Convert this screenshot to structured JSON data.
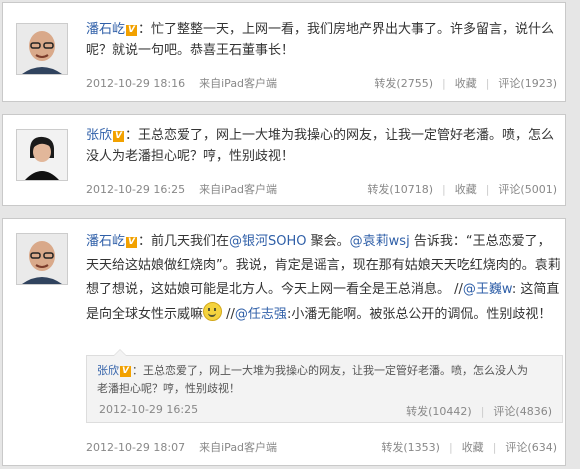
{
  "posts": [
    {
      "author": "潘石屹",
      "verified": "V",
      "text": "：忙了整整一天，上网一看，我们房地产界出大事了。许多留言，说什么呢？就说一句吧。恭喜王石董事长！",
      "time": "2012-10-29 18:16",
      "source": "来自iPad客户端",
      "repost": "转发(2755)",
      "favorite": "收藏",
      "comment": "评论(1923)"
    },
    {
      "author": "张欣",
      "verified": "V",
      "text": "：王总恋爱了，网上一大堆为我操心的网友，让我一定管好老潘。喷，怎么没人为老潘担心呢？哼，性别歧视！",
      "time": "2012-10-29 16:25",
      "source": "来自iPad客户端",
      "repost": "转发(10718)",
      "favorite": "收藏",
      "comment": "评论(5001)"
    },
    {
      "author": "潘石屹",
      "verified": "V",
      "segments": {
        "s1": "：前几天我们在",
        "l1": "@银河SOHO",
        "s2": " 聚会。",
        "l2": "@袁莉wsj",
        "s3": " 告诉我：“王总恋爱了，天天给这姑娘做红烧肉”。我说，肯定是谣言，现在那有姑娘天天吃红烧肉的。袁莉想了想说，这姑娘可能是北方人。今天上网一看全是王总消息。 //",
        "l3": "@王巍w",
        "s4": ": 这简直是向全球女性示威嘛",
        "s5": " //",
        "l4": "@任志强",
        "s6": ":小潘无能啊。被张总公开的调侃。性别歧视！"
      },
      "smiley": "smiley-icon",
      "quote": {
        "author": "张欣",
        "verified": "V",
        "text": "：王总恋爱了，网上一大堆为我操心的网友，让我一定管好老潘。喷，怎么没人为老潘担心呢？哼，性别歧视！",
        "time": "2012-10-29 16:25",
        "repost": "转发(10442)",
        "comment": "评论(4836)"
      },
      "time": "2012-10-29 18:07",
      "source": "来自iPad客户端",
      "repost": "转发(1353)",
      "favorite": "收藏",
      "comment": "评论(634)"
    }
  ],
  "colors": {
    "link": "#2f5fa8",
    "badge": "#f2a100",
    "text": "#333333",
    "meta": "#888888"
  }
}
